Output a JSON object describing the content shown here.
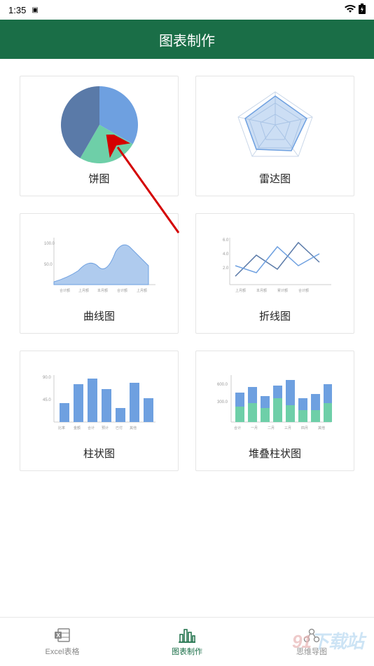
{
  "status": {
    "time": "1:35",
    "badge": "▣"
  },
  "header": {
    "title": "图表制作"
  },
  "charts": [
    {
      "id": "pie",
      "label": "饼图"
    },
    {
      "id": "radar",
      "label": "雷达图"
    },
    {
      "id": "area",
      "label": "曲线图"
    },
    {
      "id": "line",
      "label": "折线图"
    },
    {
      "id": "bar",
      "label": "柱状图"
    },
    {
      "id": "stacked",
      "label": "堆叠柱状图"
    }
  ],
  "nav": {
    "items": [
      {
        "id": "excel",
        "label": "Excel表格"
      },
      {
        "id": "chart",
        "label": "图表制作"
      },
      {
        "id": "mindmap",
        "label": "思维导图"
      }
    ],
    "active": "chart"
  },
  "watermark": {
    "text_main": "91",
    "text_sub": "下载站"
  },
  "colors": {
    "primary": "#1a6e47",
    "blue": "#6ea0e0",
    "blue_dark": "#5a7aa8",
    "green": "#6ecfa8",
    "arrow": "#d40000"
  }
}
